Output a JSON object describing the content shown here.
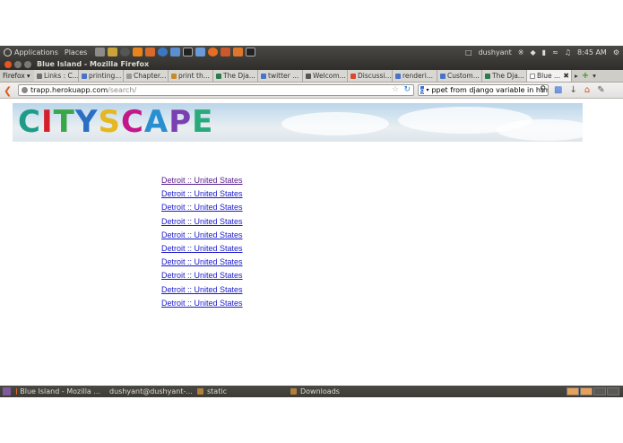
{
  "panel": {
    "menus": [
      "Applications",
      "Places"
    ],
    "user": "dushyant",
    "clock": "8:45 AM"
  },
  "window": {
    "title": "Blue Island - Mozilla Firefox"
  },
  "tabbar": {
    "menu_label": "Firefox",
    "tabs": [
      {
        "label": "Links : C...",
        "color": "#6f6f6f"
      },
      {
        "label": "printing...",
        "color": "#4a74c9"
      },
      {
        "label": "Chapter...",
        "color": "#999999"
      },
      {
        "label": "print th...",
        "color": "#c98b2a"
      },
      {
        "label": "The Dja...",
        "color": "#2d7a4f"
      },
      {
        "label": "twitter ...",
        "color": "#4a74c9"
      },
      {
        "label": "Welcom...",
        "color": "#555555"
      },
      {
        "label": "Discussi...",
        "color": "#d94a2c"
      },
      {
        "label": "renderi...",
        "color": "#4a74c9"
      },
      {
        "label": "Custom...",
        "color": "#4a74c9"
      },
      {
        "label": "The Dja...",
        "color": "#2d7a4f"
      },
      {
        "label": "Blue ...",
        "color": "#ffffff"
      }
    ]
  },
  "navbar": {
    "url_host": "trapp.herokuapp.com",
    "url_path": "/search/",
    "search_text": "ppet from  django variable in html"
  },
  "page": {
    "logo_letters": [
      {
        "ch": "C",
        "color": "#1e9c8a"
      },
      {
        "ch": "I",
        "color": "#d4202a"
      },
      {
        "ch": "T",
        "color": "#3aa64a"
      },
      {
        "ch": "Y",
        "color": "#2a6fc4"
      },
      {
        "ch": "S",
        "color": "#e6b820"
      },
      {
        "ch": "C",
        "color": "#c2188a"
      },
      {
        "ch": "A",
        "color": "#2a8fd0"
      },
      {
        "ch": "P",
        "color": "#7a3fb0"
      },
      {
        "ch": "E",
        "color": "#2aaa7a"
      }
    ],
    "results": [
      "Detroit :: United States",
      "Detroit :: United States",
      "Detroit :: United States",
      "Detroit :: United States",
      "Detroit :: United States",
      "Detroit :: United States",
      "Detroit :: United States",
      "Detroit :: United States",
      "Detroit :: United States",
      "Detroit :: United States"
    ]
  },
  "taskbar": {
    "tasks": [
      {
        "label": "Blue Island - Mozilla ...",
        "color": "#e66a2c"
      },
      {
        "label": "dushyant@dushyant-...",
        "color": "#333333"
      },
      {
        "label": "static",
        "color": "#b0813c"
      },
      {
        "label": "Downloads",
        "color": "#b0813c"
      }
    ]
  }
}
